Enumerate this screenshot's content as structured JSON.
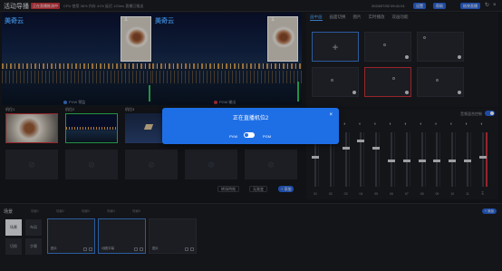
{
  "topbar": {
    "title": "活动导播",
    "live_badge": "正在直播推流中",
    "status": "CPU 使用 36%  内存 41%  延迟 120ms  直播已推送",
    "clock": "2024/07/02  09:41:01",
    "buttons": [
      "设置",
      "帮助",
      "结束直播"
    ]
  },
  "monitors": {
    "pvw": {
      "logo": "美奇云",
      "number": "1",
      "caption": "PVW 预监",
      "dot_color": "#3a7bd5"
    },
    "pgm": {
      "logo": "美奇云",
      "number": "1",
      "caption": "PGM 输出",
      "dot_color": "#c8323a"
    }
  },
  "sources": {
    "labels": [
      "机位1",
      "机位2",
      "机位3"
    ],
    "select_left": "转场特效",
    "select_right": "无渐变",
    "primary": "+ 添加"
  },
  "right_panel": {
    "tabs": [
      "画中画",
      "画面切换",
      "图片",
      "实时播放",
      "双画功能"
    ],
    "active_tab": 0
  },
  "mixer": {
    "title": "音频混合控制",
    "channels": [
      "01",
      "02",
      "03",
      "04",
      "05",
      "06",
      "07",
      "08",
      "09",
      "10",
      "11",
      "主"
    ]
  },
  "bottom": {
    "title": "场景",
    "tabs": [
      "场景1",
      "场景2",
      "场景3",
      "场景4",
      "场景5"
    ],
    "add_label": "+ 添加",
    "scene_buttons": [
      "场景",
      "布局",
      "切换",
      "字幕"
    ],
    "cards": [
      "图片",
      "动图字幕",
      "图片"
    ]
  },
  "modal": {
    "title": "正在直播机位2",
    "left_label": "PVW",
    "right_label": "PGM"
  }
}
